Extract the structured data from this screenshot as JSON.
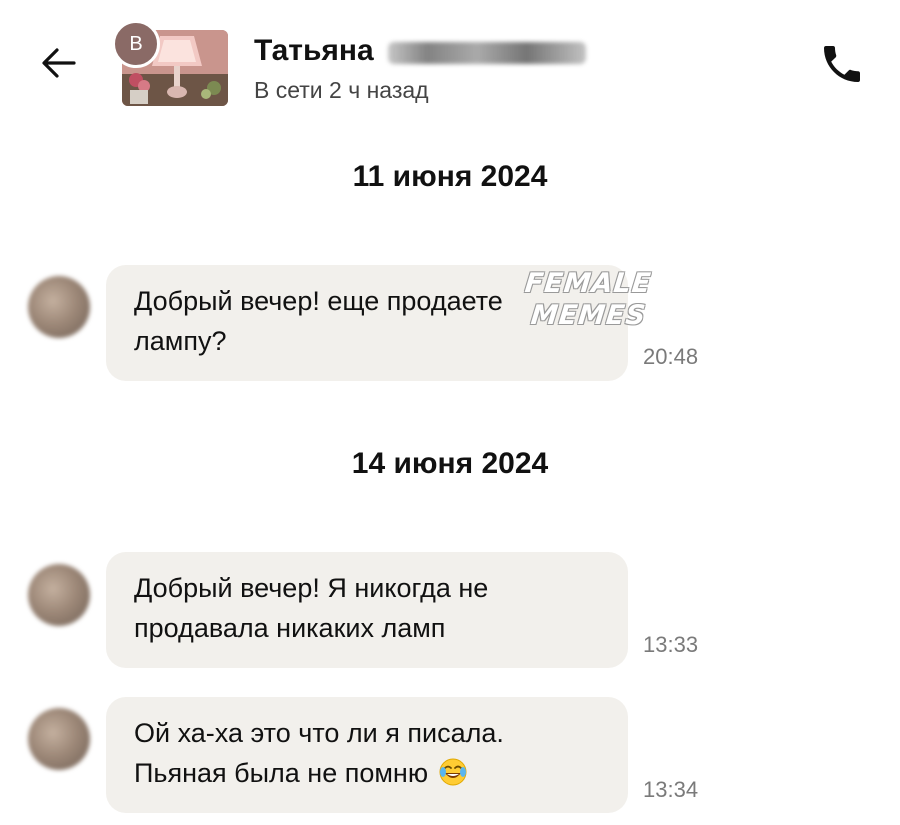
{
  "header": {
    "back_icon": "arrow-left-icon",
    "avatar_initial": "В",
    "contact_name": "Татьяна",
    "status": "В сети 2 ч назад",
    "call_icon": "phone-icon"
  },
  "watermark": {
    "line1": "FEMALE",
    "line2": "MEMES"
  },
  "conversation": {
    "date_1": "11 июня 2024",
    "date_2": "14 июня 2024",
    "messages": [
      {
        "line1": "Добрый вечер! еще продаете",
        "line2": "лампу?",
        "time": "20:48"
      },
      {
        "line1": "Добрый вечер! Я никогда не",
        "line2": "продавала никаких ламп",
        "time": "13:33"
      },
      {
        "line1": "Ой ха-ха это что ли я писала.",
        "line2": "Пьяная была не помню",
        "emoji": "face-with-tears-of-joy-emoji",
        "time": "13:34"
      }
    ]
  },
  "colors": {
    "bubble_background": "#f2f0ec",
    "time_text": "#7a7a7a",
    "avatar_badge": "#8a6a66"
  }
}
